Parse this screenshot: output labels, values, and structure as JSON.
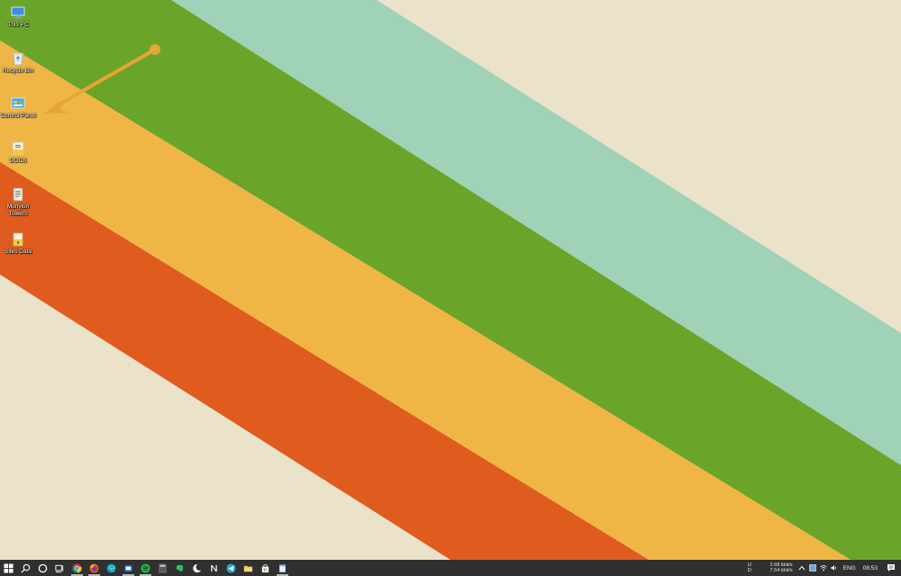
{
  "desktop": {
    "wallpaper_colors": {
      "background": "#ebe2ca",
      "mint": "#9fd2b6",
      "green": "#6aa52a",
      "yellow": "#f0b645",
      "orange": "#e05b1e",
      "arrow": "#e6a535"
    },
    "icons": [
      {
        "label": "This PC",
        "icon": "computer-icon"
      },
      {
        "label": "Recycle Bin",
        "icon": "recycle-bin-icon"
      },
      {
        "label": "Control Panel",
        "icon": "control-panel-icon"
      },
      {
        "label": "DOCS",
        "icon": "folder-docs-icon"
      },
      {
        "label": "Munyiuri Towers",
        "icon": "document-icon"
      },
      {
        "label": "Sites Data",
        "icon": "folder-icon"
      }
    ]
  },
  "taskbar": {
    "background": "#2f302f",
    "pinned": [
      {
        "name": "start",
        "icon": "windows-logo-icon"
      },
      {
        "name": "search",
        "icon": "search-icon"
      },
      {
        "name": "cortana",
        "icon": "cortana-circle-icon"
      },
      {
        "name": "task-view",
        "icon": "task-view-icon"
      },
      {
        "name": "chrome",
        "icon": "chrome-icon"
      },
      {
        "name": "firefox",
        "icon": "firefox-icon"
      },
      {
        "name": "edge",
        "icon": "edge-icon"
      },
      {
        "name": "store-app",
        "icon": "store-icon"
      },
      {
        "name": "spotify",
        "icon": "spotify-icon"
      },
      {
        "name": "calculator",
        "icon": "calculator-icon"
      },
      {
        "name": "evernote",
        "icon": "evernote-icon"
      },
      {
        "name": "moon-app",
        "icon": "moon-icon"
      },
      {
        "name": "notion",
        "icon": "notion-icon"
      },
      {
        "name": "telegram",
        "icon": "telegram-icon"
      },
      {
        "name": "file-explorer",
        "icon": "folder-icon"
      },
      {
        "name": "microsoft-store",
        "icon": "shopping-bag-icon"
      },
      {
        "name": "notepad",
        "icon": "notepad-icon"
      }
    ],
    "tray": {
      "net_up_label": "U:",
      "net_up_value": "2.68 kbit/s",
      "net_down_label": "D:",
      "net_down_value": "7.54 kbit/s",
      "language": "ENG",
      "time": "08:53"
    }
  }
}
